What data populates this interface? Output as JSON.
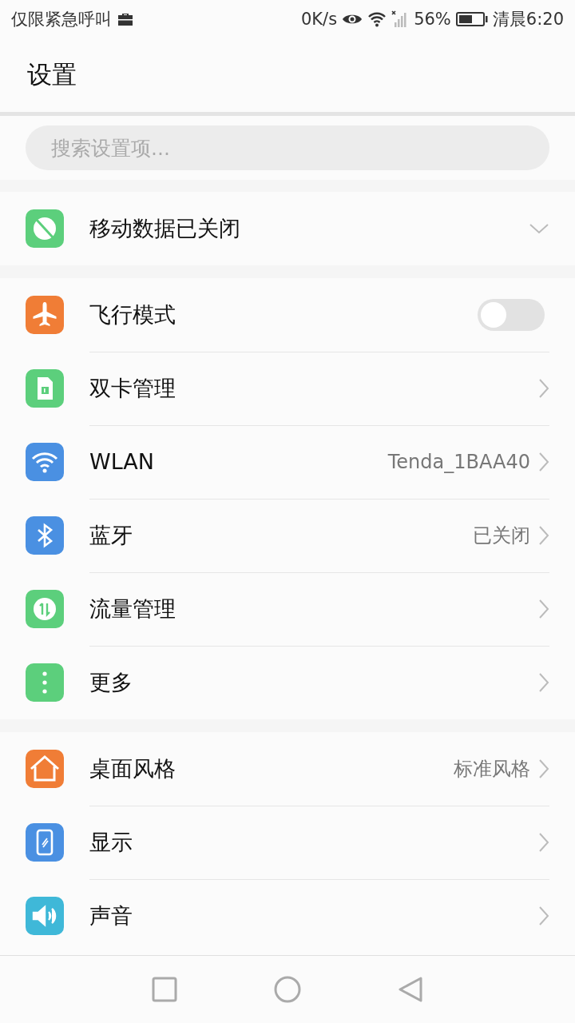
{
  "status_bar": {
    "carrier": "仅限紧急呼叫",
    "speed": "0K/s",
    "battery": "56%",
    "time": "清晨6:20"
  },
  "title": "设置",
  "search": {
    "placeholder": "搜索设置项..."
  },
  "sections": [
    {
      "items": [
        {
          "kind": "expand",
          "label": "移动数据已关闭",
          "color": "#5ccf7c",
          "expanded": false
        }
      ]
    },
    {
      "items": [
        {
          "kind": "toggle",
          "label": "飞行模式",
          "color": "#f07d36",
          "on": false
        },
        {
          "kind": "link",
          "label": "双卡管理",
          "color": "#5ccf7c"
        },
        {
          "kind": "link",
          "label": "WLAN",
          "color": "#4a90e2",
          "value": "Tenda_1BAA40"
        },
        {
          "kind": "link",
          "label": "蓝牙",
          "color": "#4a90e2",
          "value": "已关闭"
        },
        {
          "kind": "link",
          "label": "流量管理",
          "color": "#5ccf7c"
        },
        {
          "kind": "link",
          "label": "更多",
          "color": "#5ccf7c"
        }
      ]
    },
    {
      "items": [
        {
          "kind": "link",
          "label": "桌面风格",
          "color": "#f07d36",
          "value": "标准风格"
        },
        {
          "kind": "link",
          "label": "显示",
          "color": "#4a90e2"
        },
        {
          "kind": "link",
          "label": "声音",
          "color": "#3fb8d8"
        }
      ]
    }
  ]
}
